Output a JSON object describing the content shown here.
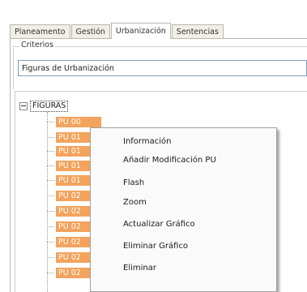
{
  "tabs": [
    {
      "label": "Planeamento"
    },
    {
      "label": "Gestión"
    },
    {
      "label": "Urbanización"
    },
    {
      "label": "Sentencias"
    }
  ],
  "criterios": {
    "label": "Criterios",
    "selected": "Figuras de Urbanización"
  },
  "tree": {
    "root_label": "FIGURAS",
    "items": [
      {
        "label": "PU 00"
      },
      {
        "label": "PU 01"
      },
      {
        "label": "PU 01"
      },
      {
        "label": "PU 01"
      },
      {
        "label": "PU 01"
      },
      {
        "label": "PU 02"
      },
      {
        "label": "PU 02"
      },
      {
        "label": "PU 02"
      },
      {
        "label": "PU 02"
      },
      {
        "label": "PU 02"
      },
      {
        "label": "PU 02"
      }
    ]
  },
  "context_menu": {
    "items": [
      {
        "label": "Información"
      },
      {
        "label": "Añadir Modificación PU"
      },
      {
        "label": "Flash"
      },
      {
        "label": "Zoom"
      },
      {
        "label": "Actualizar Gráfico"
      },
      {
        "label": "Eliminar Gráfico"
      },
      {
        "label": "Eliminar"
      }
    ]
  },
  "colors": {
    "selection": "#f3a35d",
    "menu_background": "#fafafa"
  }
}
